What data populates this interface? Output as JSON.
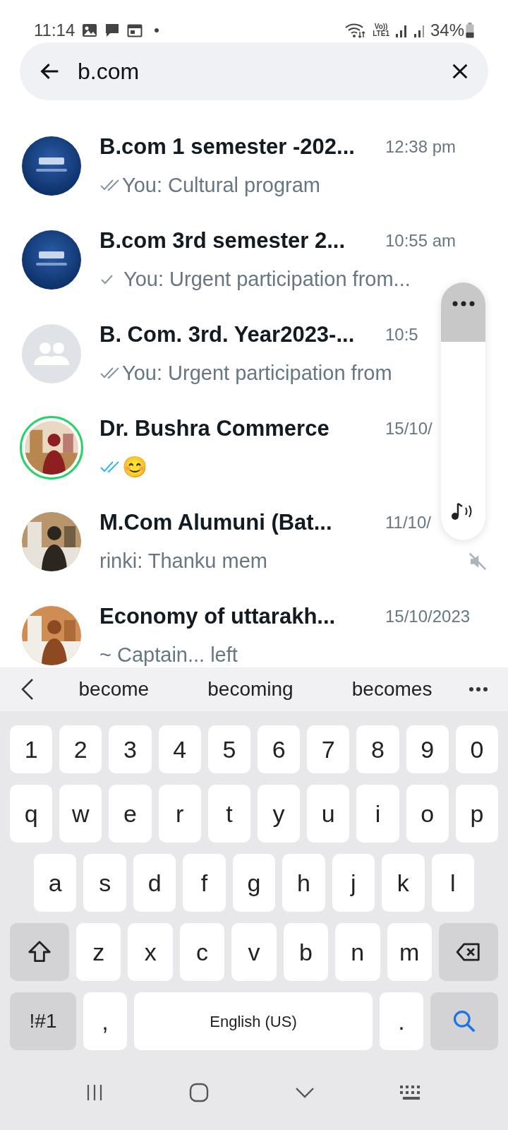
{
  "status_bar": {
    "time": "11:14",
    "network": "Vo))\nLTE1",
    "battery": "34%"
  },
  "search": {
    "value": "b.com"
  },
  "chats": [
    {
      "name": "B.com 1 semester -202...",
      "time": "12:38 pm",
      "preview": "You: Cultural program",
      "receipt": {
        "kind": "double",
        "read": false
      },
      "avatar": {
        "kind": "logo"
      },
      "status_ring": false,
      "muted": false
    },
    {
      "name": "B.com 3rd  semester 2...",
      "time": "10:55 am",
      "preview": "You: Urgent participation from...",
      "receipt": {
        "kind": "single",
        "read": false
      },
      "avatar": {
        "kind": "logo"
      },
      "status_ring": false,
      "muted": false
    },
    {
      "name": "B. Com. 3rd. Year2023-...",
      "time": "10:5",
      "preview": "You: Urgent participation from",
      "receipt": {
        "kind": "double",
        "read": false
      },
      "avatar": {
        "kind": "group"
      },
      "status_ring": false,
      "muted": false
    },
    {
      "name": "Dr. Bushra Commerce",
      "time": "15/10/",
      "preview": "😊",
      "receipt": {
        "kind": "double",
        "read": true
      },
      "status_ring": true,
      "muted": false
    },
    {
      "name": "M.Com Alumuni (Bat...",
      "time": "11/10/",
      "preview": "rinki: Thanku mem",
      "status_ring": false,
      "muted": true
    },
    {
      "name": "Economy of uttarakh...",
      "time": "15/10/2023",
      "preview": "~ Captain... left",
      "status_ring": false,
      "muted": false
    }
  ],
  "volume_panel": {
    "level": 0.77
  },
  "keyboard": {
    "suggestions": [
      "become",
      "becoming",
      "becomes"
    ],
    "rows": [
      {
        "keys": [
          {
            "kind": "char",
            "label": "1"
          },
          {
            "kind": "char",
            "label": "2"
          },
          {
            "kind": "char",
            "label": "3"
          },
          {
            "kind": "char",
            "label": "4"
          },
          {
            "kind": "char",
            "label": "5"
          },
          {
            "kind": "char",
            "label": "6"
          },
          {
            "kind": "char",
            "label": "7"
          },
          {
            "kind": "char",
            "label": "8"
          },
          {
            "kind": "char",
            "label": "9"
          },
          {
            "kind": "char",
            "label": "0"
          }
        ]
      },
      {
        "keys": [
          {
            "kind": "char",
            "label": "q"
          },
          {
            "kind": "char",
            "label": "w"
          },
          {
            "kind": "char",
            "label": "e"
          },
          {
            "kind": "char",
            "label": "r"
          },
          {
            "kind": "char",
            "label": "t"
          },
          {
            "kind": "char",
            "label": "y"
          },
          {
            "kind": "char",
            "label": "u"
          },
          {
            "kind": "char",
            "label": "i"
          },
          {
            "kind": "char",
            "label": "o"
          },
          {
            "kind": "char",
            "label": "p"
          }
        ]
      },
      {
        "keys": [
          {
            "kind": "char",
            "label": "a"
          },
          {
            "kind": "char",
            "label": "s"
          },
          {
            "kind": "char",
            "label": "d"
          },
          {
            "kind": "char",
            "label": "f"
          },
          {
            "kind": "char",
            "label": "g"
          },
          {
            "kind": "char",
            "label": "h"
          },
          {
            "kind": "char",
            "label": "j"
          },
          {
            "kind": "char",
            "label": "k"
          },
          {
            "kind": "char",
            "label": "l"
          }
        ]
      },
      {
        "keys": [
          {
            "kind": "shift"
          },
          {
            "kind": "char",
            "label": "z"
          },
          {
            "kind": "char",
            "label": "x"
          },
          {
            "kind": "char",
            "label": "c"
          },
          {
            "kind": "char",
            "label": "v"
          },
          {
            "kind": "char",
            "label": "b"
          },
          {
            "kind": "char",
            "label": "n"
          },
          {
            "kind": "char",
            "label": "m"
          },
          {
            "kind": "backspace"
          }
        ]
      },
      {
        "keys": [
          {
            "kind": "symbols",
            "label": "!#1"
          },
          {
            "kind": "char",
            "label": ","
          },
          {
            "kind": "space",
            "label": "English (US)"
          },
          {
            "kind": "char",
            "label": "."
          },
          {
            "kind": "search"
          }
        ]
      }
    ]
  }
}
